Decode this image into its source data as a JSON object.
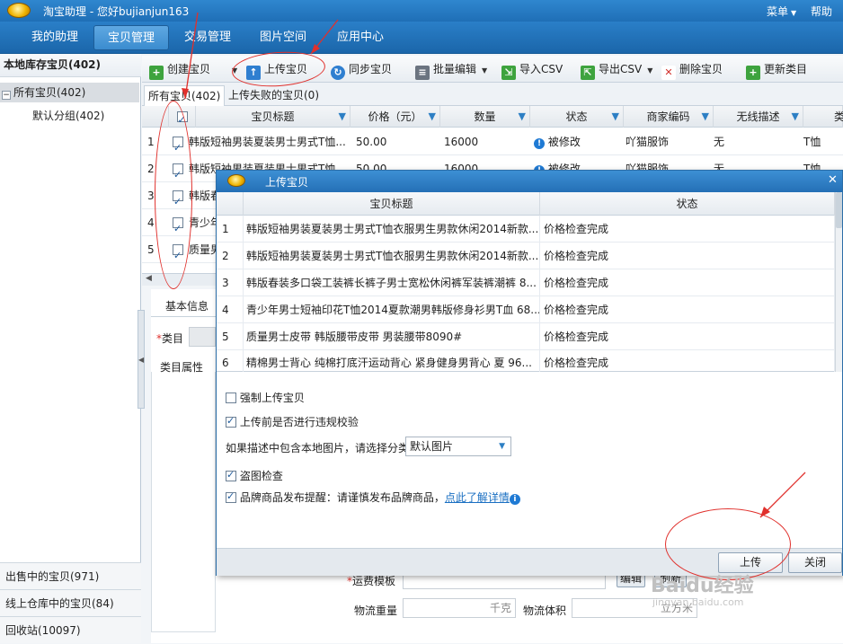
{
  "app": {
    "title": "淘宝助理 - 您好bujianjun163",
    "menu_label": "菜单",
    "help_label": "帮助"
  },
  "nav": {
    "tabs": [
      {
        "label": "我的助理"
      },
      {
        "label": "宝贝管理"
      },
      {
        "label": "交易管理"
      },
      {
        "label": "图片空间"
      },
      {
        "label": "应用中心"
      }
    ]
  },
  "sidebar": {
    "header": "本地库存宝贝(402)",
    "all_items": "所有宝贝(402)",
    "default_group": "默认分组(402)",
    "footer": [
      {
        "label": "出售中的宝贝(971)"
      },
      {
        "label": "线上仓库中的宝贝(84)"
      },
      {
        "label": "回收站(10097)"
      }
    ]
  },
  "toolbar": {
    "create": "创建宝贝",
    "upload": "上传宝贝",
    "sync": "同步宝贝",
    "batch_edit": "批量编辑",
    "import_csv": "导入CSV",
    "export_csv": "导出CSV",
    "delete": "删除宝贝",
    "update_category": "更新类目"
  },
  "subtabs": {
    "all": "所有宝贝(402)",
    "failed": "上传失败的宝贝(0)"
  },
  "grid": {
    "columns": [
      "宝贝标题",
      "价格（元）",
      "数量",
      "状态",
      "商家编码",
      "无线描述",
      "类"
    ],
    "rows": [
      {
        "num": "1",
        "title": "韩版短袖男装夏装男士男式T恤...",
        "price": "50.00",
        "qty": "16000",
        "status": "被修改",
        "code": "吖猫服饰",
        "wireless": "无",
        "cat": "T恤"
      },
      {
        "num": "2",
        "title": "韩版短袖男装夏装男士男式T恤...",
        "price": "50.00",
        "qty": "16000",
        "status": "被修改",
        "code": "吖猫服饰",
        "wireless": "无",
        "cat": "T恤"
      },
      {
        "num": "3",
        "title": "韩版春"
      },
      {
        "num": "4",
        "title": "青少年"
      },
      {
        "num": "5",
        "title": "质量男"
      }
    ]
  },
  "detail": {
    "basic_info": "基本信息",
    "category_label": "类目",
    "category_required": "*",
    "attrs_label": "类目属性",
    "shipping_template": "运费模板",
    "edit_btn": "编辑",
    "refresh_btn": "刷新",
    "weight_label": "物流重量",
    "weight_unit": "千克",
    "volume_label": "物流体积",
    "volume_unit": "立方米"
  },
  "dialog": {
    "title": "上传宝贝",
    "columns": [
      "宝贝标题",
      "状态"
    ],
    "rows": [
      {
        "num": "1",
        "title": "韩版短袖男装夏装男士男式T恤衣服男生男款休闲2014新款...",
        "status": "价格检查完成"
      },
      {
        "num": "2",
        "title": "韩版短袖男装夏装男士男式T恤衣服男生男款休闲2014新款...",
        "status": "价格检查完成"
      },
      {
        "num": "3",
        "title": "韩版春装多口袋工装裤长裤子男士宽松休闲裤军装裤潮裤 8...",
        "status": "价格检查完成"
      },
      {
        "num": "4",
        "title": "青少年男士短袖印花T恤2014夏款潮男韩版修身衫男T血 68...",
        "status": "价格检查完成"
      },
      {
        "num": "5",
        "title": "质量男士皮带 韩版腰带皮带 男装腰带8090#",
        "status": "价格检查完成"
      },
      {
        "num": "6",
        "title": "精棉男士背心 纯棉打底汗运动背心 紧身健身男背心 夏 96...",
        "status": "价格检查完成"
      }
    ],
    "options": {
      "force_upload": "强制上传宝贝",
      "force_upload_checked": false,
      "check_violation": "上传前是否进行违规校验",
      "check_violation_checked": true,
      "local_image_label": "如果描述中包含本地图片，请选择分类",
      "local_image_value": "默认图片",
      "theft_check": "盗图检查",
      "theft_check_checked": true,
      "brand_reminder": "品牌商品发布提醒：请谨慎发布品牌商品，",
      "brand_reminder_checked": true,
      "brand_link": "点此了解详情"
    },
    "upload_btn": "上传",
    "close_btn": "关闭"
  },
  "watermark": {
    "brand": "Baidu经验",
    "url": "jingyan.baidu.com"
  },
  "colors": {
    "title_blue": "#2470b6",
    "annotation_red": "#e0302c",
    "link_blue": "#1a6fc2"
  }
}
